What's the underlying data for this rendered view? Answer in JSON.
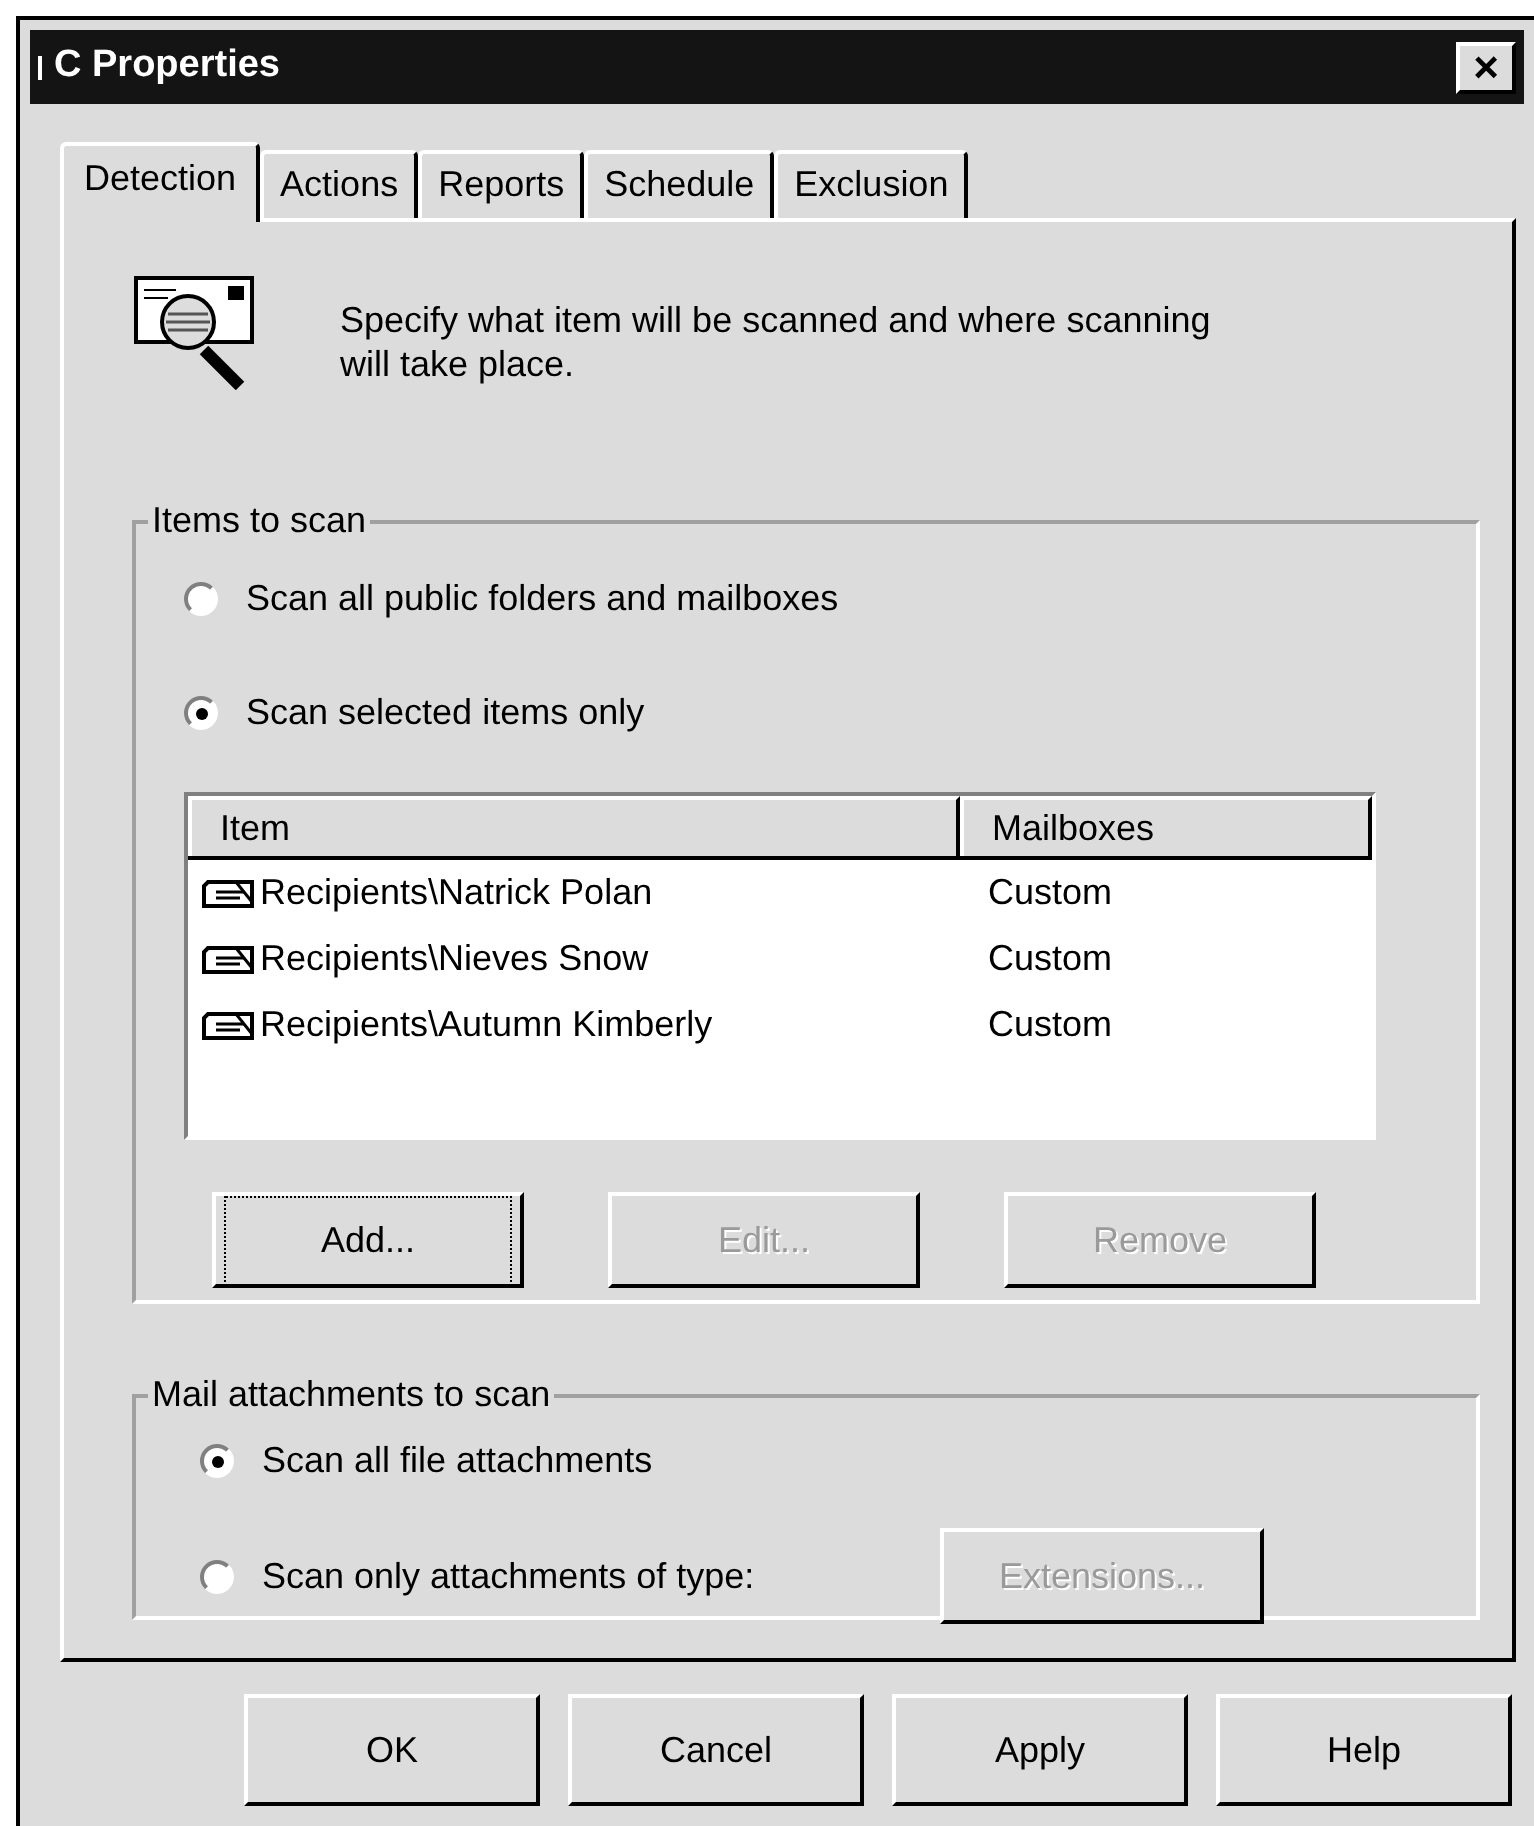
{
  "window": {
    "title": "C Properties",
    "close": "×"
  },
  "tabs": [
    {
      "label": "Detection",
      "selected": true
    },
    {
      "label": "Actions",
      "selected": false
    },
    {
      "label": "Reports",
      "selected": false
    },
    {
      "label": "Schedule",
      "selected": false
    },
    {
      "label": "Exclusion",
      "selected": false
    }
  ],
  "description": "Specify what item will be scanned and where scanning will take place.",
  "items_group": {
    "title": "Items to scan",
    "options": [
      {
        "label": "Scan all public folders and mailboxes",
        "selected": false
      },
      {
        "label": "Scan selected items only",
        "selected": true
      }
    ],
    "table": {
      "columns": [
        "Item",
        "Mailboxes"
      ],
      "rows": [
        [
          "Recipients\\Natrick Polan",
          "Custom"
        ],
        [
          "Recipients\\Nieves Snow",
          "Custom"
        ],
        [
          "Recipients\\Autumn Kimberly",
          "Custom"
        ]
      ]
    },
    "buttons": [
      {
        "label": "Add...",
        "disabled": false,
        "focused": true
      },
      {
        "label": "Edit...",
        "disabled": true,
        "focused": false
      },
      {
        "label": "Remove",
        "disabled": true,
        "focused": false
      }
    ]
  },
  "attachments_group": {
    "title": "Mail attachments to scan",
    "options": [
      {
        "label": "Scan all file attachments",
        "selected": true
      },
      {
        "label": "Scan only attachments of type:",
        "selected": false
      }
    ],
    "extensions_button": {
      "label": "Extensions...",
      "disabled": true
    }
  },
  "buttons": [
    "OK",
    "Cancel",
    "Apply",
    "Help"
  ]
}
